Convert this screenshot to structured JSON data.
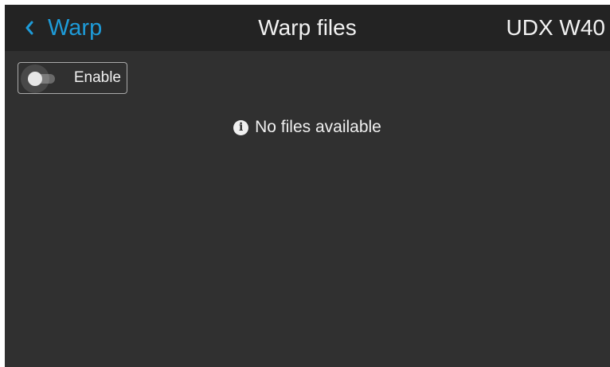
{
  "header": {
    "back_label": "Warp",
    "title": "Warp files",
    "device_name": "UDX W40"
  },
  "toolbar": {
    "enable_label": "Enable",
    "enable_state": "off"
  },
  "content": {
    "empty_message": "No files available",
    "info_icon_glyph": "i"
  },
  "icons": {
    "back": "chevron-left-icon",
    "info": "info-icon"
  },
  "colors": {
    "accent": "#1e9bd8",
    "header_background": "#232323",
    "screen_background": "#303030",
    "text": "#f0f0f0"
  }
}
